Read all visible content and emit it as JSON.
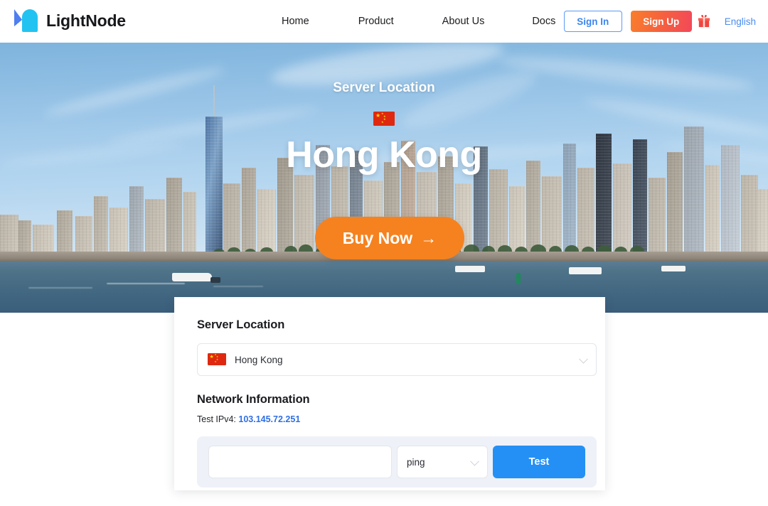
{
  "nav": {
    "brand": "LightNode",
    "logo_icon": "lightnode-logo-icon",
    "links": [
      {
        "label": "Home"
      },
      {
        "label": "Product"
      },
      {
        "label": "About Us"
      },
      {
        "label": "Docs"
      }
    ],
    "sign_in": "Sign In",
    "sign_up": "Sign Up",
    "gift_icon": "gift-icon",
    "language": "English"
  },
  "hero": {
    "kicker": "Server Location",
    "flag_icon": "china-flag-icon",
    "title": "Hong Kong",
    "buy_label": "Buy Now",
    "buy_arrow": "→"
  },
  "card": {
    "location_section_title": "Server Location",
    "location_flag_icon": "china-flag-icon",
    "location_value": "Hong Kong",
    "location_chevron_icon": "chevron-down-icon",
    "network_section_title": "Network Information",
    "ipv4_label": "Test IPv4:",
    "ipv4_value": "103.145.72.251",
    "test_input_value": "",
    "test_input_placeholder": "",
    "test_method": "ping",
    "test_method_chevron_icon": "chevron-down-icon",
    "test_button": "Test"
  },
  "colors": {
    "accent_orange": "#f5821f",
    "accent_blue": "#2490f5",
    "link_blue": "#2f6fe4",
    "signin_blue": "#3c86ee",
    "signup_gradient_start": "#f97e2c",
    "signup_gradient_end": "#f3485a",
    "panel_bg": "#eef1f8",
    "flag_red": "#de2910",
    "flag_yellow": "#ffde00"
  }
}
